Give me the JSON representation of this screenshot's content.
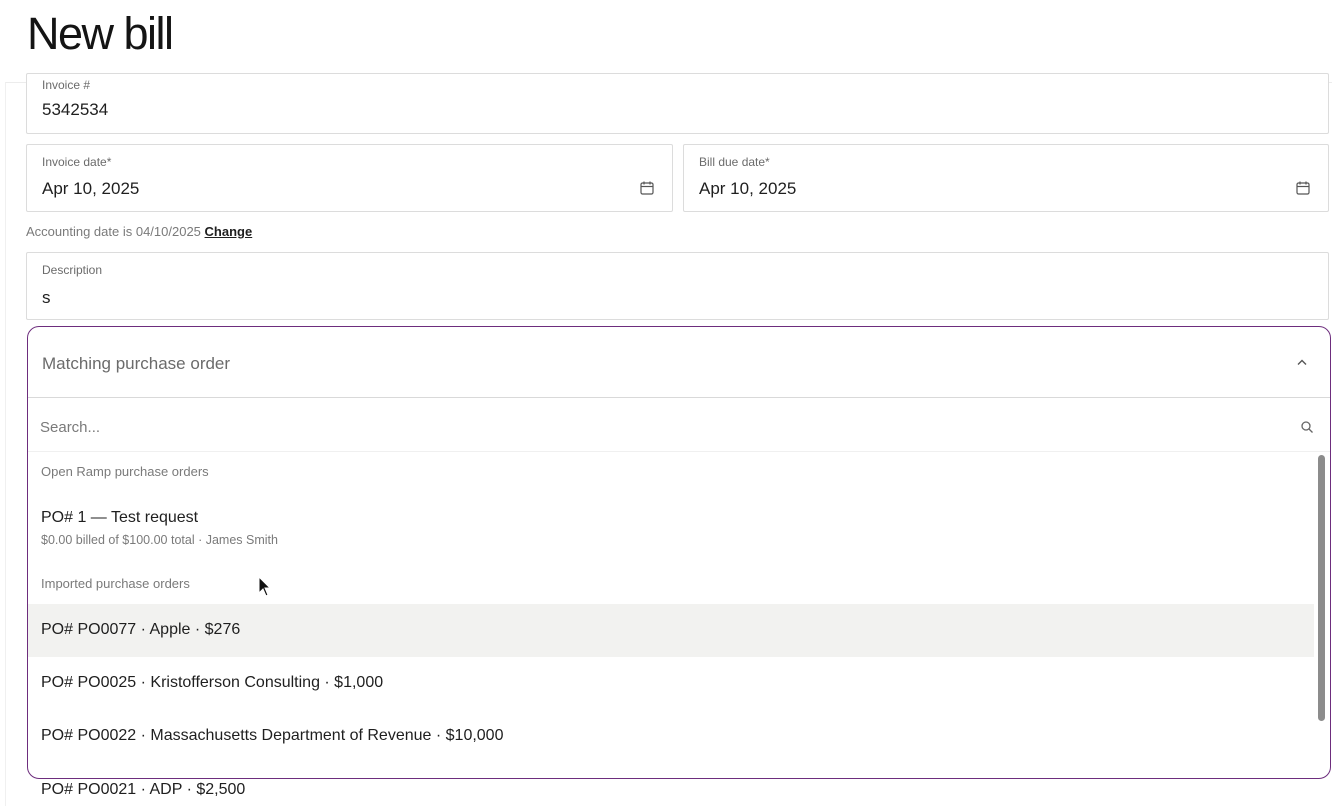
{
  "page": {
    "title": "New bill"
  },
  "invoice_number": {
    "label": "Invoice #",
    "value": "5342534"
  },
  "invoice_date": {
    "label": "Invoice date*",
    "value": "Apr 10, 2025"
  },
  "bill_due_date": {
    "label": "Bill due date*",
    "value": "Apr 10, 2025"
  },
  "accounting": {
    "note": "Accounting date is 04/10/2025",
    "change_link": "Change"
  },
  "description": {
    "label": "Description",
    "value": "s"
  },
  "matching_po": {
    "label": "Matching purchase order",
    "search_placeholder": "Search...",
    "open_group_label": "Open Ramp purchase orders",
    "open_items": [
      {
        "title": "PO# 1 — Test request",
        "subtitle": "$0.00 billed of $100.00 total · James Smith"
      }
    ],
    "imported_group_label": "Imported purchase orders",
    "imported_items": [
      {
        "title": "PO# PO0077 · Apple · $276"
      },
      {
        "title": "PO# PO0025 · Kristofferson Consulting · $1,000"
      },
      {
        "title": "PO# PO0022 · Massachusetts Department of Revenue · $10,000"
      },
      {
        "title": "PO# PO0021 · ADP · $2,500"
      }
    ]
  },
  "colors": {
    "accent_border": "#6d2d7d",
    "hover_row": "#f2f2f0"
  },
  "icons": {
    "calendar": "calendar-icon",
    "chevron": "chevron-up-icon",
    "search": "search-icon"
  }
}
